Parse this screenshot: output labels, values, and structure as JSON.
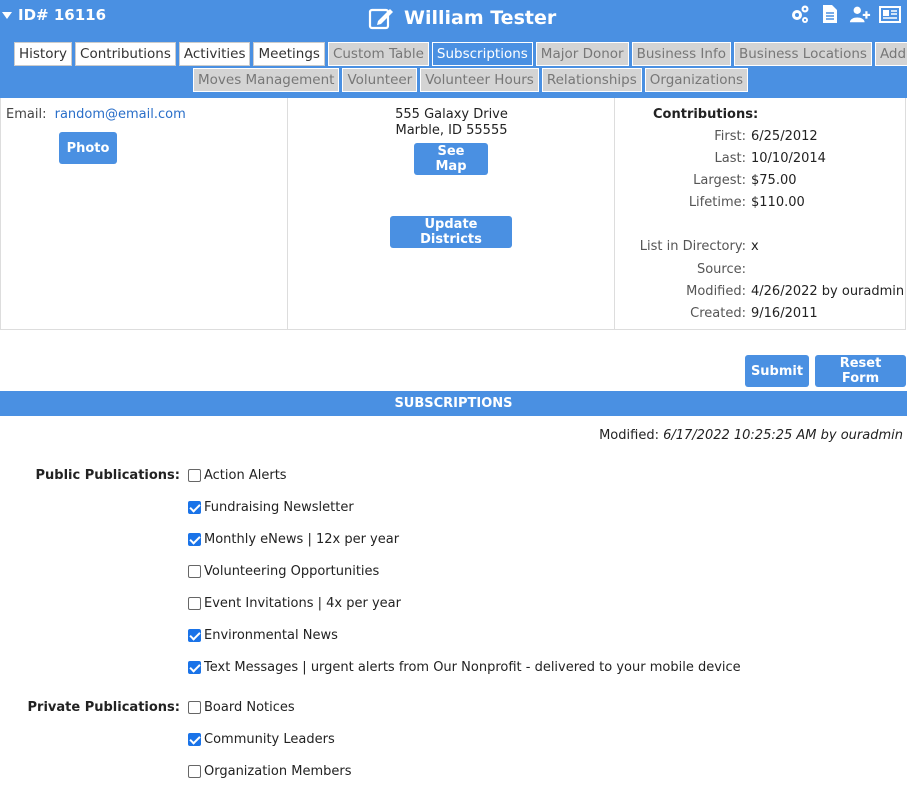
{
  "header": {
    "id_label": "ID# 16116",
    "name": "William Tester",
    "colors": {
      "bar": "#4a90e2",
      "text": "#ffffff"
    }
  },
  "tabs_row1": [
    {
      "label": "History",
      "state": "on"
    },
    {
      "label": "Contributions",
      "state": "on"
    },
    {
      "label": "Activities",
      "state": "on"
    },
    {
      "label": "Meetings",
      "state": "on"
    },
    {
      "label": "Custom Table",
      "state": "off"
    },
    {
      "label": "Subscriptions",
      "state": "active"
    },
    {
      "label": "Major Donor",
      "state": "off"
    },
    {
      "label": "Business Info",
      "state": "off"
    },
    {
      "label": "Business Locations",
      "state": "off"
    },
    {
      "label": "Addl Addr",
      "state": "off"
    }
  ],
  "tabs_row2": [
    {
      "label": "Moves Management",
      "state": "off"
    },
    {
      "label": "Volunteer",
      "state": "off"
    },
    {
      "label": "Volunteer Hours",
      "state": "off"
    },
    {
      "label": "Relationships",
      "state": "off"
    },
    {
      "label": "Organizations",
      "state": "off"
    }
  ],
  "contact": {
    "email_label": "Email:",
    "email": "random@email.com",
    "photo_button": "Photo"
  },
  "address": {
    "line1": "555 Galaxy Drive",
    "line2": "Marble, ID 55555",
    "see_map_button": "See Map",
    "update_districts_button": "Update Districts"
  },
  "stats": {
    "heading": "Contributions:",
    "rows": [
      {
        "k": "First:",
        "v": "6/25/2012"
      },
      {
        "k": "Last:",
        "v": "10/10/2014"
      },
      {
        "k": "Largest:",
        "v": "$75.00"
      },
      {
        "k": "Lifetime:",
        "v": "$110.00"
      },
      {
        "k": "List in Directory:",
        "v": "x"
      },
      {
        "k": "Source:",
        "v": ""
      },
      {
        "k": "Modified:",
        "v": "4/26/2022 by ouradmin"
      },
      {
        "k": "Created:",
        "v": "9/16/2011"
      }
    ]
  },
  "form": {
    "submit_button": "Submit",
    "reset_button": "Reset Form",
    "section_title": "SUBSCRIPTIONS",
    "modified_label": "Modified:",
    "modified_value": "6/17/2022 10:25:25 AM by ouradmin"
  },
  "public_publications": {
    "label": "Public Publications:",
    "items": [
      {
        "label": "Action Alerts",
        "checked": false
      },
      {
        "label": "Fundraising Newsletter",
        "checked": true
      },
      {
        "label": "Monthly eNews | 12x per year",
        "checked": true
      },
      {
        "label": "Volunteering Opportunities",
        "checked": false
      },
      {
        "label": "Event Invitations | 4x per year",
        "checked": false
      },
      {
        "label": "Environmental News",
        "checked": true
      },
      {
        "label": "Text Messages | urgent alerts from Our Nonprofit - delivered to your mobile device",
        "checked": true
      }
    ]
  },
  "private_publications": {
    "label": "Private Publications:",
    "items": [
      {
        "label": "Board Notices",
        "checked": false
      },
      {
        "label": "Community Leaders",
        "checked": true
      },
      {
        "label": "Organization Members",
        "checked": false
      }
    ]
  }
}
